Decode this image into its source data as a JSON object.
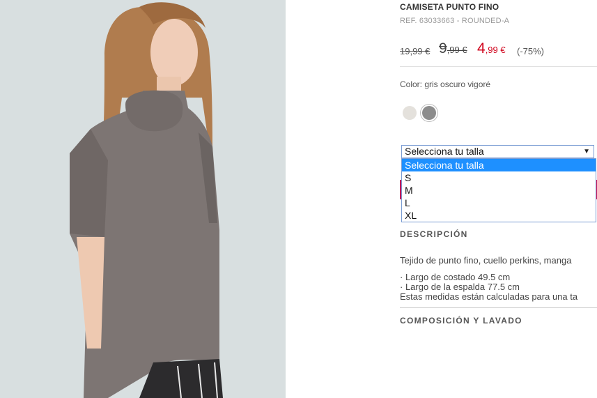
{
  "product": {
    "title": "CAMISETA PUNTO FINO",
    "ref": "REF. 63033663 - ROUNDED-A",
    "image_alt": "Model wearing grey turtleneck knit t-shirt"
  },
  "prices": {
    "original": "19,99 €",
    "previous_int": "9",
    "previous_dec": ",99 €",
    "current_int": "4",
    "current_dec": ",99 €",
    "discount": "(-75%)",
    "sale_color": "#d0021b"
  },
  "color": {
    "label": "Color: gris oscuro vigoré",
    "swatches": [
      {
        "name": "light",
        "color": "#e4e1dc"
      },
      {
        "name": "dark-grey",
        "color": "#8c8c8c",
        "selected": true
      }
    ]
  },
  "size_select": {
    "value": "Selecciona tu talla",
    "options": [
      "Selecciona tu talla",
      "S",
      "M",
      "L",
      "XL"
    ],
    "highlighted": "Selecciona tu talla"
  },
  "description": {
    "title": "DESCRIPCIÓN",
    "text": "Tejido de punto fino, cuello perkins, manga",
    "lines": [
      "· Largo de costado 49.5 cm",
      "· Largo de la espalda 77.5 cm",
      "Estas medidas están calculadas para una ta"
    ]
  },
  "composition": {
    "title": "COMPOSICIÓN Y LAVADO"
  }
}
